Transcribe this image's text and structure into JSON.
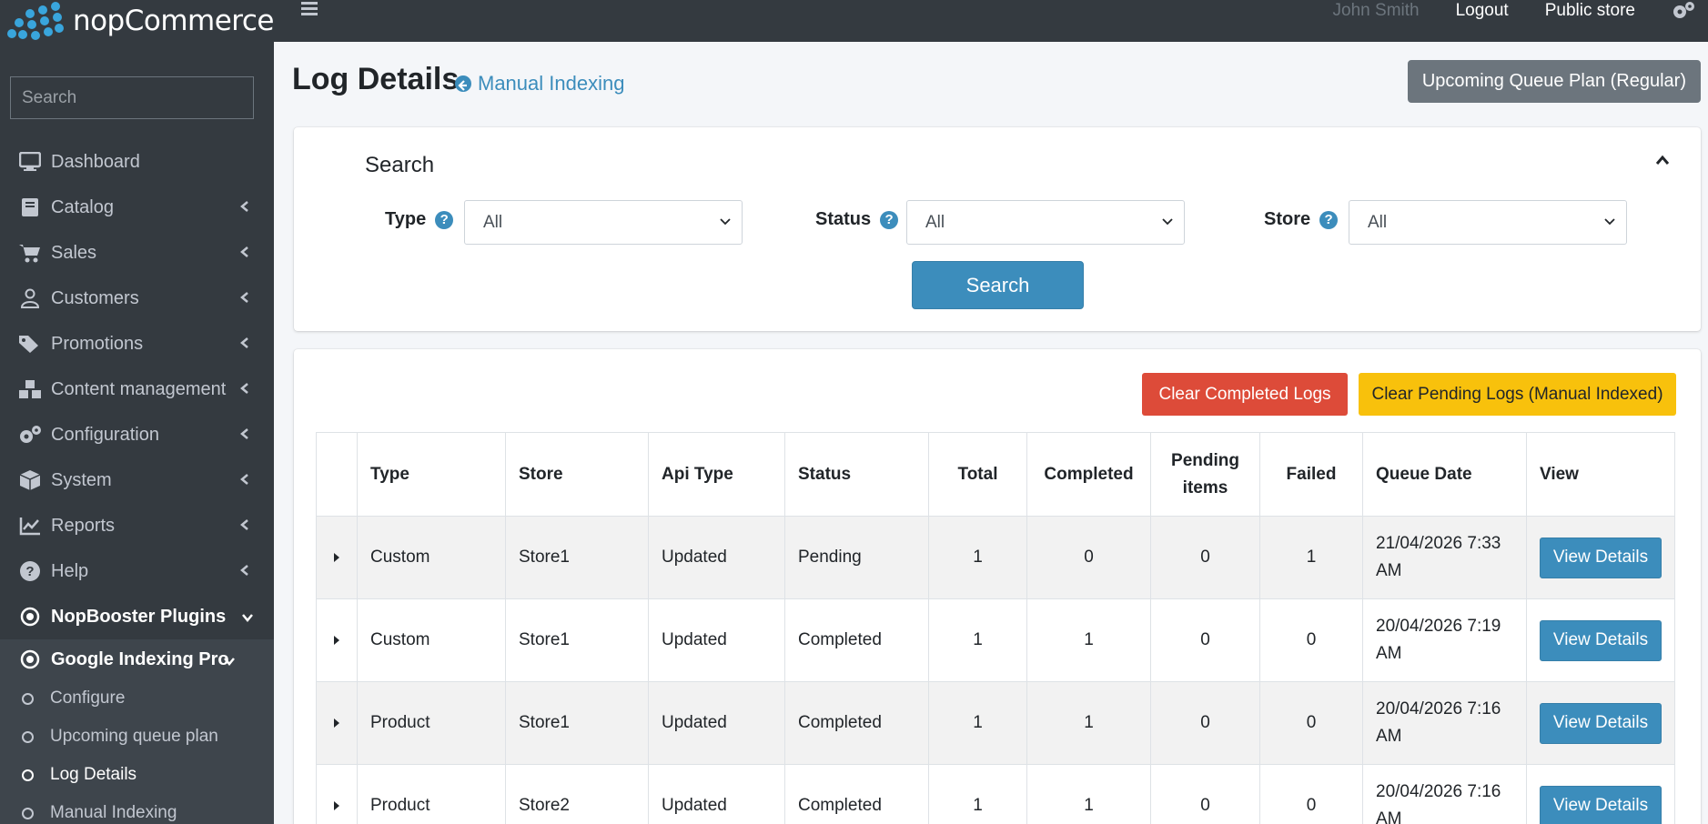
{
  "brand": {
    "name": "nopCommerce"
  },
  "sidebar": {
    "search_placeholder": "Search",
    "items": [
      {
        "label": "Dashboard",
        "icon": "monitor-icon"
      },
      {
        "label": "Catalog",
        "icon": "book-icon"
      },
      {
        "label": "Sales",
        "icon": "cart-icon"
      },
      {
        "label": "Customers",
        "icon": "user-icon"
      },
      {
        "label": "Promotions",
        "icon": "tags-icon"
      },
      {
        "label": "Content management",
        "icon": "cubes-icon"
      },
      {
        "label": "Configuration",
        "icon": "gears-icon"
      },
      {
        "label": "System",
        "icon": "cube-icon"
      },
      {
        "label": "Reports",
        "icon": "chart-icon"
      },
      {
        "label": "Help",
        "icon": "question-icon"
      }
    ],
    "plugins_label": "NopBooster Plugins",
    "group_label": "Google Indexing Pro",
    "sub_items": [
      {
        "label": "Configure"
      },
      {
        "label": "Upcoming queue plan"
      },
      {
        "label": "Log Details"
      },
      {
        "label": "Manual Indexing"
      }
    ]
  },
  "topbar": {
    "user_name": "John Smith",
    "logout": "Logout",
    "public_store": "Public store"
  },
  "page": {
    "title": "Log Details",
    "back_link": "Manual Indexing",
    "queue_button": "Upcoming Queue Plan (Regular)"
  },
  "search": {
    "title": "Search",
    "type_label": "Type",
    "type_value": "All",
    "status_label": "Status",
    "status_value": "All",
    "store_label": "Store",
    "store_value": "All",
    "button": "Search"
  },
  "actions": {
    "clear_completed": "Clear Completed Logs",
    "clear_pending": "Clear Pending Logs (Manual Indexed)"
  },
  "table": {
    "headers": [
      "Type",
      "Store",
      "Api Type",
      "Status",
      "Total",
      "Completed",
      "Pending items",
      "Failed",
      "Queue Date",
      "View"
    ],
    "rows": [
      {
        "type": "Custom",
        "store": "Store1",
        "api_type": "Updated",
        "status": "Pending",
        "total": "1",
        "completed": "0",
        "pending": "0",
        "failed": "1",
        "date_line1": "21/04/2026 7:33",
        "date_line2": "AM",
        "view": "View Details"
      },
      {
        "type": "Custom",
        "store": "Store1",
        "api_type": "Updated",
        "status": "Completed",
        "total": "1",
        "completed": "1",
        "pending": "0",
        "failed": "0",
        "date_line1": "20/04/2026 7:19",
        "date_line2": "AM",
        "view": "View Details"
      },
      {
        "type": "Product",
        "store": "Store1",
        "api_type": "Updated",
        "status": "Completed",
        "total": "1",
        "completed": "1",
        "pending": "0",
        "failed": "0",
        "date_line1": "20/04/2026 7:16",
        "date_line2": "AM",
        "view": "View Details"
      },
      {
        "type": "Product",
        "store": "Store2",
        "api_type": "Updated",
        "status": "Completed",
        "total": "1",
        "completed": "1",
        "pending": "0",
        "failed": "0",
        "date_line1": "20/04/2026 7:16",
        "date_line2": "AM",
        "view": "View Details"
      }
    ]
  },
  "colors": {
    "sidebar": "#343a40",
    "primary": "#3c8dbc",
    "danger": "#dd4b39",
    "warning": "#f8c10c",
    "secondary": "#6c757d"
  }
}
